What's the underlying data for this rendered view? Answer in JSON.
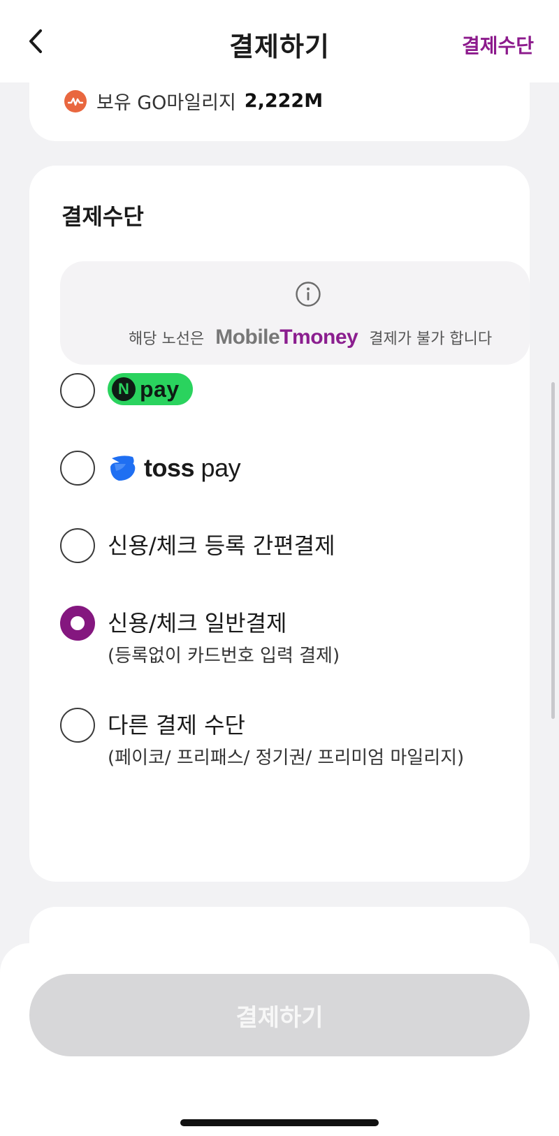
{
  "header": {
    "title": "결제하기",
    "right_action": "결제수단"
  },
  "mileage": {
    "label": "보유 GO마일리지",
    "value": "2,222M"
  },
  "payment_methods": {
    "title": "결제수단",
    "notice": {
      "prefix": "해당 노선은",
      "logo_mobile": "Mobile",
      "logo_tmoney": "Tmoney",
      "suffix": "결제가 불가 합니다"
    },
    "options": [
      {
        "id": "npay",
        "logo_n": "N",
        "logo_text": "pay",
        "selected": false
      },
      {
        "id": "tosspay",
        "logo_bold": "toss",
        "logo_text": "pay",
        "selected": false
      },
      {
        "id": "registered-card",
        "label": "신용/체크 등록 간편결제",
        "selected": false
      },
      {
        "id": "general-card",
        "label": "신용/체크 일반결제",
        "sub": "(등록없이 카드번호 입력 결제)",
        "selected": true
      },
      {
        "id": "other",
        "label": "다른 결제 수단",
        "sub": "(페이코/ 프리패스/ 정기권/ 프리미엄 마일리지)",
        "selected": false
      }
    ]
  },
  "bottom": {
    "pay_button": "결제하기"
  },
  "colors": {
    "accent": "#84177f",
    "npay_green": "#2ad35e",
    "toss_blue": "#1f6ff2",
    "mileage_orange": "#e9673f",
    "disabled_button": "#d7d7d9"
  }
}
